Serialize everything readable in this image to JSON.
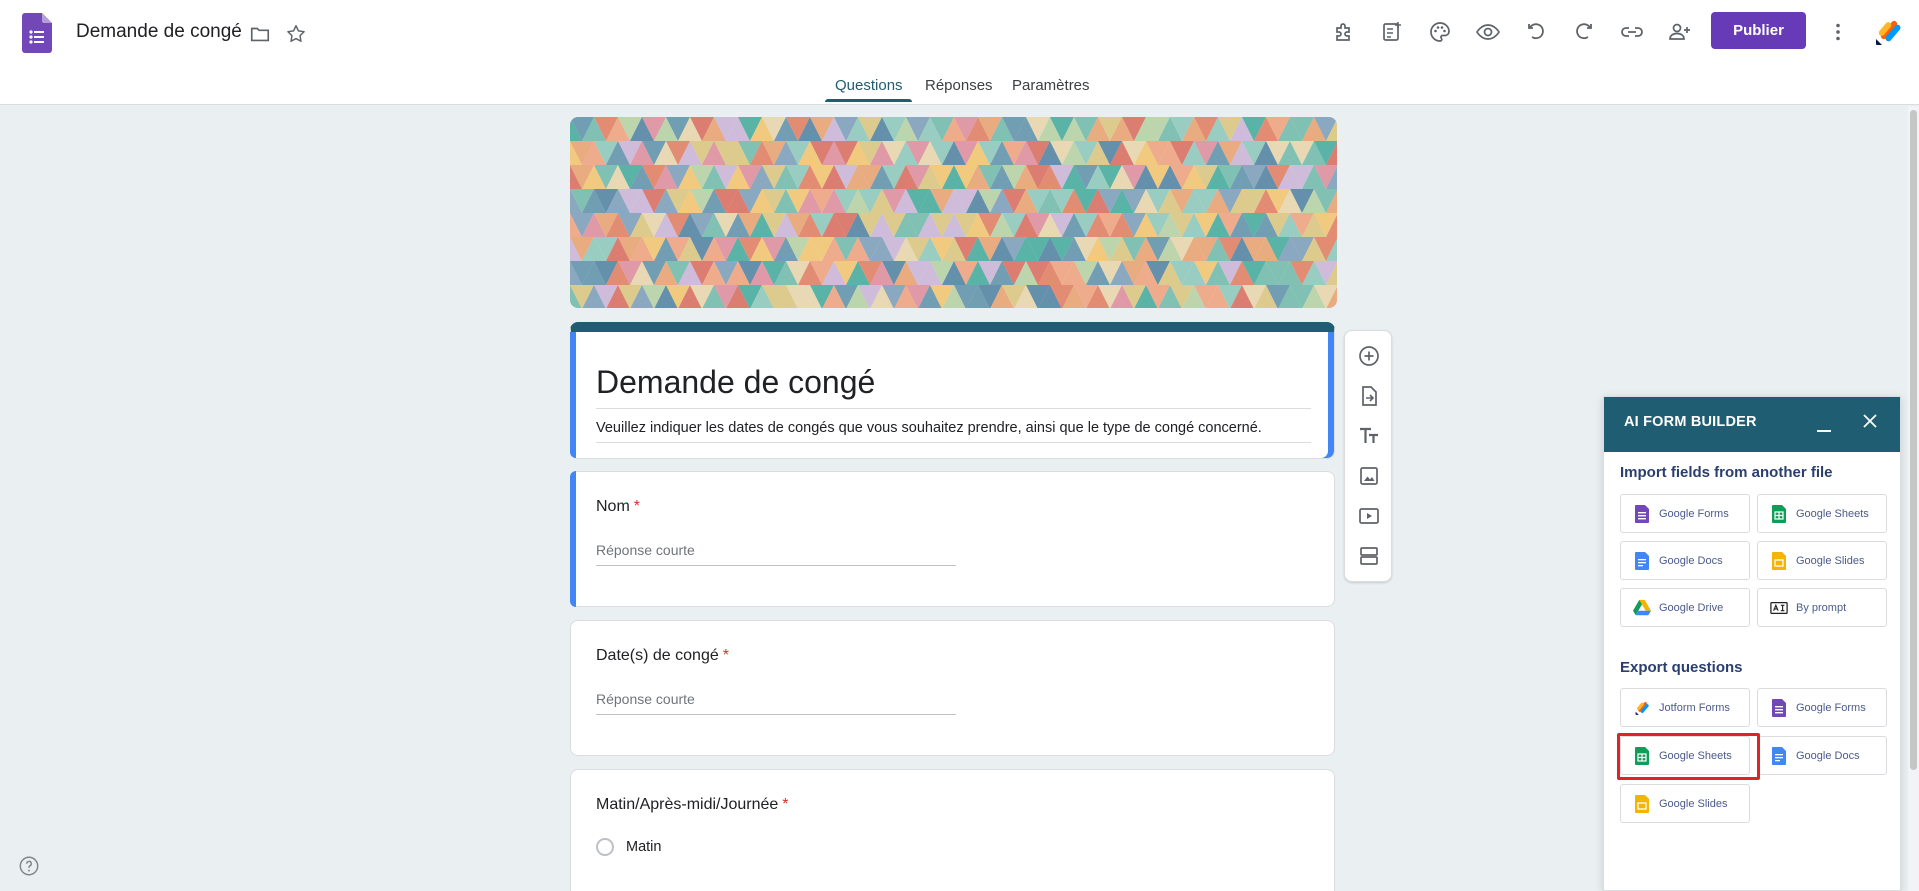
{
  "header": {
    "doc_title": "Demande de congé",
    "publish_label": "Publier",
    "icons": [
      "addons-icon",
      "quiz-icon",
      "palette-icon",
      "preview-icon",
      "undo-icon",
      "redo-icon",
      "link-icon",
      "add-collaborator-icon",
      "more-vert-icon",
      "jotform-icon"
    ]
  },
  "tabs": [
    {
      "label": "Questions",
      "active": true
    },
    {
      "label": "Réponses",
      "active": false
    },
    {
      "label": "Paramètres",
      "active": false
    }
  ],
  "form": {
    "title": "Demande de congé",
    "description": "Veuillez indiquer les dates de congés que vous souhaitez prendre, ainsi que le type de congé concerné.",
    "questions": [
      {
        "title": "Nom",
        "required_mark": "*",
        "placeholder": "Réponse courte"
      },
      {
        "title": "Date(s) de congé",
        "required_mark": "*",
        "placeholder": "Réponse courte"
      },
      {
        "title": "Matin/Après-midi/Journée",
        "required_mark": "*",
        "options": [
          "Matin"
        ]
      }
    ]
  },
  "side_toolbar": [
    "add-question-icon",
    "import-questions-icon",
    "add-title-icon",
    "add-image-icon",
    "add-video-icon",
    "add-section-icon"
  ],
  "ai_panel": {
    "title": "AI FORM BUILDER",
    "import_heading": "Import fields from another file",
    "import_items": [
      {
        "label": "Google Forms",
        "icon": "google-forms-icon"
      },
      {
        "label": "Google Sheets",
        "icon": "google-sheets-icon"
      },
      {
        "label": "Google Docs",
        "icon": "google-docs-icon"
      },
      {
        "label": "Google Slides",
        "icon": "google-slides-icon"
      },
      {
        "label": "Google Drive",
        "icon": "google-drive-icon"
      },
      {
        "label": "By prompt",
        "icon": "prompt-icon"
      }
    ],
    "export_heading": "Export questions",
    "export_items": [
      {
        "label": "Jotform Forms",
        "icon": "jotform-icon"
      },
      {
        "label": "Google Forms",
        "icon": "google-forms-icon"
      },
      {
        "label": "Google Sheets",
        "icon": "google-sheets-icon"
      },
      {
        "label": "Google Docs",
        "icon": "google-docs-icon"
      },
      {
        "label": "Google Slides",
        "icon": "google-slides-icon"
      }
    ]
  },
  "colors": {
    "accent": "#673ab7",
    "theme": "#1f5d73",
    "highlight": "#e02424"
  }
}
